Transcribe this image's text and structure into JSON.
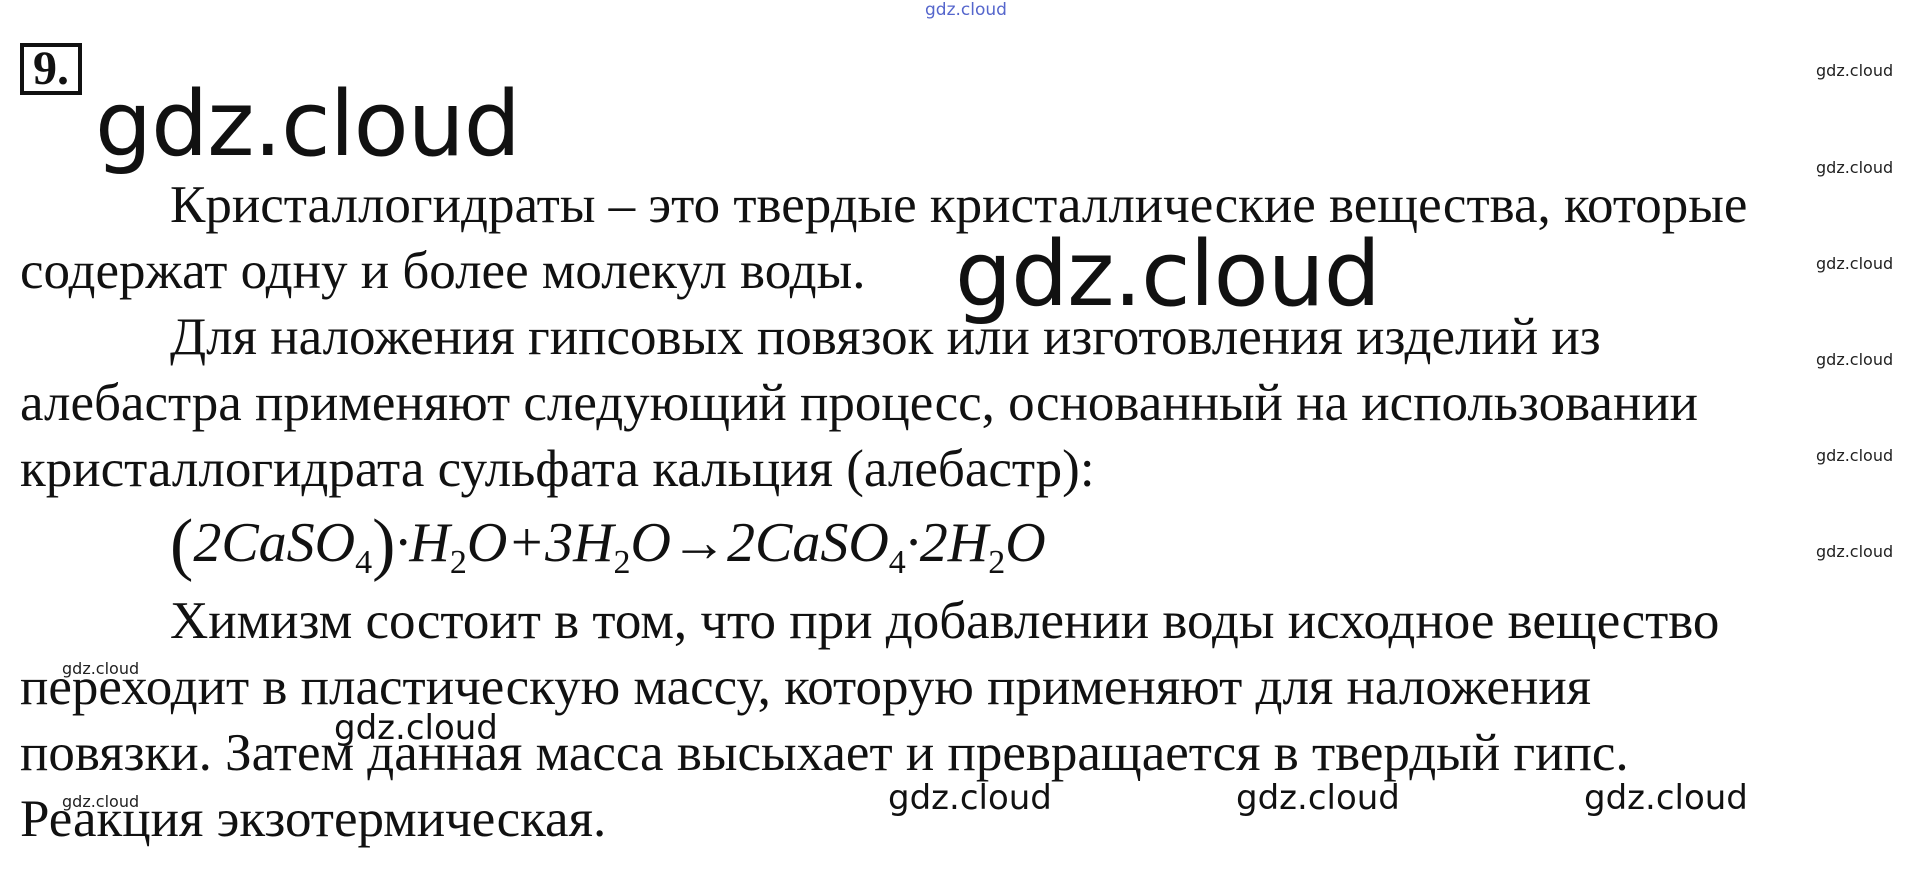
{
  "problem_number": "9.",
  "watermarks": {
    "text": "gdz.cloud"
  },
  "paragraphs": {
    "p1_line1": "Кристаллогидраты – это твердые кристаллические вещества, которые",
    "p1_line2": "содержат одну и более молекул воды.",
    "p2_line1": "Для наложения гипсовых повязок или изготовления изделий из",
    "p2_line2": "алебастра применяют следующий процесс, основанный на использовании",
    "p2_line3": "кристаллогидрата сульфата кальция (алебастр):",
    "p3_line1": "Химизм состоит в том, что при добавлении воды исходное вещество",
    "p3_line2": "переходит в пластическую массу, которую применяют для наложения",
    "p3_line3": "повязки. Затем данная масса высыхает и превращается в твердый гипс.",
    "p3_line4": "Реакция экзотермическая."
  },
  "equation": {
    "lparen": "(",
    "rparen": ")",
    "t1": "2CaSO",
    "s1": "4",
    "t2": "·H",
    "s2": "2",
    "t3": "O+3H",
    "s3": "2",
    "t4": "O→2CaSO",
    "s4": "4",
    "t5": "·2H",
    "s5": "2",
    "t6": "O"
  }
}
